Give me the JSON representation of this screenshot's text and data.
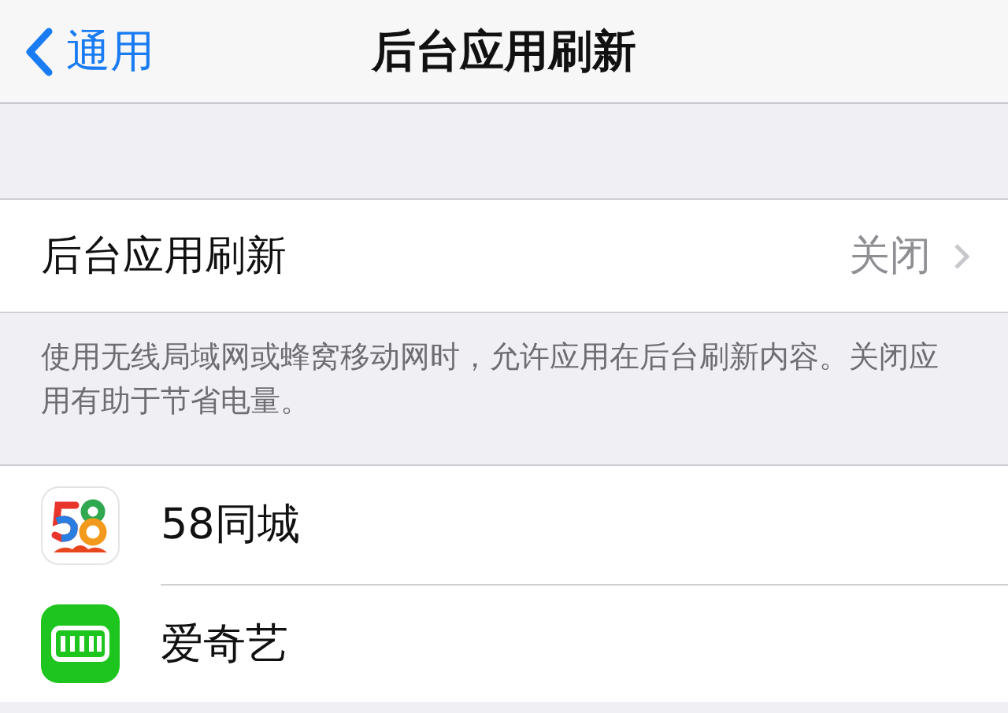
{
  "nav_bar": {
    "back": "通用",
    "title": "后台应用刷新"
  },
  "setting": {
    "label": "后台应用刷新",
    "value": "关闭"
  },
  "footer": "使用无线局域网或蜂窝移动网时，允许应用在后台刷新内容。关闭应用有助于节省电量。",
  "apps": [
    {
      "name": "58同城",
      "kind": "colorful"
    },
    {
      "name": "爱奇艺",
      "kind": "green"
    }
  ]
}
